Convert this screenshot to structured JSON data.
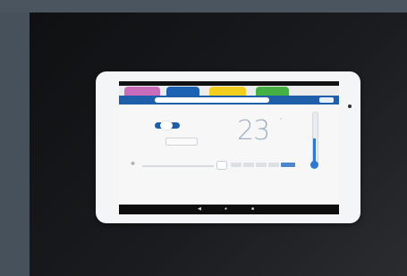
{
  "tablet": {
    "status": "",
    "tabs": [
      "",
      "",
      "",
      ""
    ],
    "segment": [
      "",
      "",
      ""
    ],
    "nav_button": "",
    "toggle_off": "",
    "toggle_on": "",
    "small_button": "",
    "temperature": "23",
    "degree_unit": "°",
    "nav_icons": [
      "◀",
      "●",
      "■"
    ]
  }
}
